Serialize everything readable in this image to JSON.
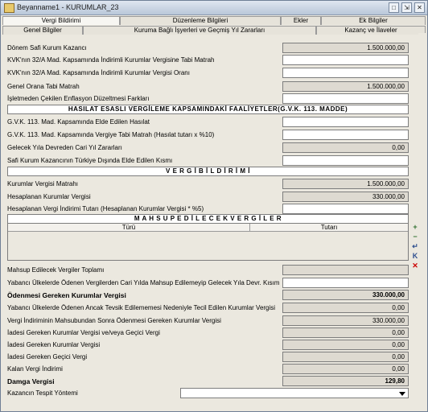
{
  "window": {
    "title": "Beyanname1 - KURUMLAR_23",
    "buttons": [
      "□",
      "⇲",
      "✕"
    ]
  },
  "tabs_top": [
    "Vergi Bildirimi",
    "Düzenleme Bilgileri",
    "Ekler",
    "Ek Bilgiler"
  ],
  "tabs_sub": [
    "Genel Bilgiler",
    "Kuruma Bağlı İşyerleri ve Geçmiş Yıl Zararları",
    "Kazanç ve İlaveler"
  ],
  "rows": {
    "donem_safi": {
      "label": "Dönem Safi Kurum Kazancı",
      "value": "1.500.000,00"
    },
    "kvk32a_matrah": {
      "label": "KVK'nın 32/A Mad. Kapsamında İndirimli Kurumlar Vergisine Tabi Matrah",
      "value": ""
    },
    "kvk32a_oran": {
      "label": "KVK'nın 32/A Mad. Kapsamında İndirimli Kurumlar Vergisi Oranı",
      "value": ""
    },
    "genel_oran": {
      "label": "Genel Orana Tabi Matrah",
      "value": "1.500.000,00"
    },
    "enflasyon": {
      "label": "İşletmeden Çekilen Enflasyon Düzeltmesi Farkları",
      "value": ""
    },
    "gvk_hasilat": {
      "label": "G.V.K. 113. Mad. Kapsamında Elde Edilen Hasılat",
      "value": ""
    },
    "gvk_matrah": {
      "label": "G.V.K. 113. Mad. Kapsamında Vergiye Tabi Matrah (Hasılat tutarı x %10)",
      "value": ""
    },
    "gelecek_zarar": {
      "label": "Gelecek Yıla Devreden Cari Yıl Zararları",
      "value": "0,00"
    },
    "safi_yurtdisi": {
      "label": "Safi Kurum Kazancının Türkiye Dışında Elde Edilen Kısmı",
      "value": ""
    },
    "kv_matrahi": {
      "label": "Kurumlar Vergisi Matrahı",
      "value": "1.500.000,00"
    },
    "hesaplanan_kv": {
      "label": "Hesaplanan Kurumlar Vergisi",
      "value": "330.000,00"
    },
    "indirim_tutari": {
      "label": "Hesaplanan Vergi İndirimi Tutarı (Hesaplanan Kurumlar Vergisi * %5)",
      "value": ""
    },
    "mahsup_toplam": {
      "label": "Mahsup Edilecek Vergiler Toplamı",
      "value": ""
    },
    "yabanci_devr": {
      "label": "Yabancı Ülkelerde Ödenen Vergilerden Cari Yılda Mahsup Edilemeyip Gelecek Yıla Devr. Kısım",
      "value": ""
    },
    "odenmesi_gereken": {
      "label": "Ödenmesi Gereken Kurumlar Vergisi",
      "value": "330.000,00"
    },
    "yabanci_tecil": {
      "label": "Yabancı Ülkelerde Ödenen Ancak Tevsik Edilememesi Nedeniyle Tecil Edilen Kurumlar Vergisi",
      "value": "0,00"
    },
    "indirim_sonra": {
      "label": "Vergi İndiriminin Mahsubundan Sonra Ödenmesi Gereken Kurumlar Vergisi",
      "value": "330.000,00"
    },
    "iade_kv_gecici": {
      "label": "İadesi Gereken Kurumlar Vergisi ve/veya Geçici Vergi",
      "value": "0,00"
    },
    "iade_kv": {
      "label": "İadesi Gereken Kurumlar Vergisi",
      "value": "0,00"
    },
    "iade_gecici": {
      "label": "İadesi Gereken Geçici Vergi",
      "value": "0,00"
    },
    "kalan_indirim": {
      "label": "Kalan Vergi İndirimi",
      "value": "0,00"
    },
    "damga": {
      "label": "Damga Vergisi",
      "value": "129,80"
    },
    "tespit": {
      "label": "Kazancın Tespit Yöntemi",
      "value": ""
    }
  },
  "sections": {
    "hasilat": "HASILAT ESASLI VERGİLEME KAPSAMINDAKİ FAALİYETLER(G.V.K. 113. MADDE)",
    "bildirim": "V E R G İ   B İ L D İ R İ M İ",
    "mahsup": "M A H S U P   E D İ L E C E K   V E R G İ L E R"
  },
  "grid": {
    "columns": [
      "Türü",
      "Tutarı"
    ]
  },
  "side_buttons": [
    "+",
    "−",
    "↵",
    "K",
    "✕"
  ],
  "colors": {
    "titlebar": "#b9c7d9",
    "panel": "#ebe8df",
    "readonly": "#dedad1"
  }
}
